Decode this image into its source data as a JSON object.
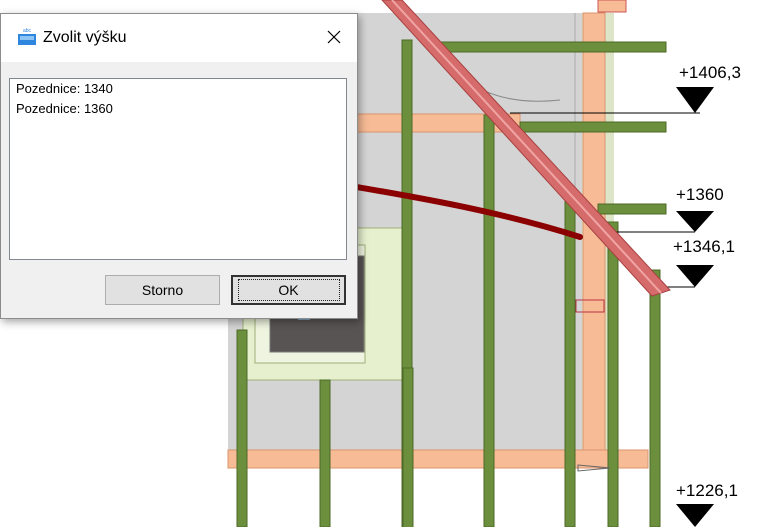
{
  "drawing": {
    "elevation_labels": [
      {
        "text": "+1406,3"
      },
      {
        "text": "+1360"
      },
      {
        "text": "+1346,1"
      },
      {
        "text": "+1226,1"
      }
    ],
    "colors": {
      "wall_fill": "#d4d4d4",
      "timber_green": "#6b8f3c",
      "plate_orange": "#f7bb96",
      "rafter_red": "#d66b6b",
      "annotation_arrow": "#8b0000",
      "window_frame": "#e6f0cf",
      "window_glass": "#595454"
    }
  },
  "dialog": {
    "title": "Zvolit výšku",
    "app_icon": "app-icon",
    "close_icon": "close-icon",
    "list_items": [
      {
        "label": "Pozednice:",
        "value": "1340"
      },
      {
        "label": "Pozednice:",
        "value": "1360"
      }
    ],
    "buttons": {
      "cancel_label": "Storno",
      "ok_label": "OK"
    }
  }
}
